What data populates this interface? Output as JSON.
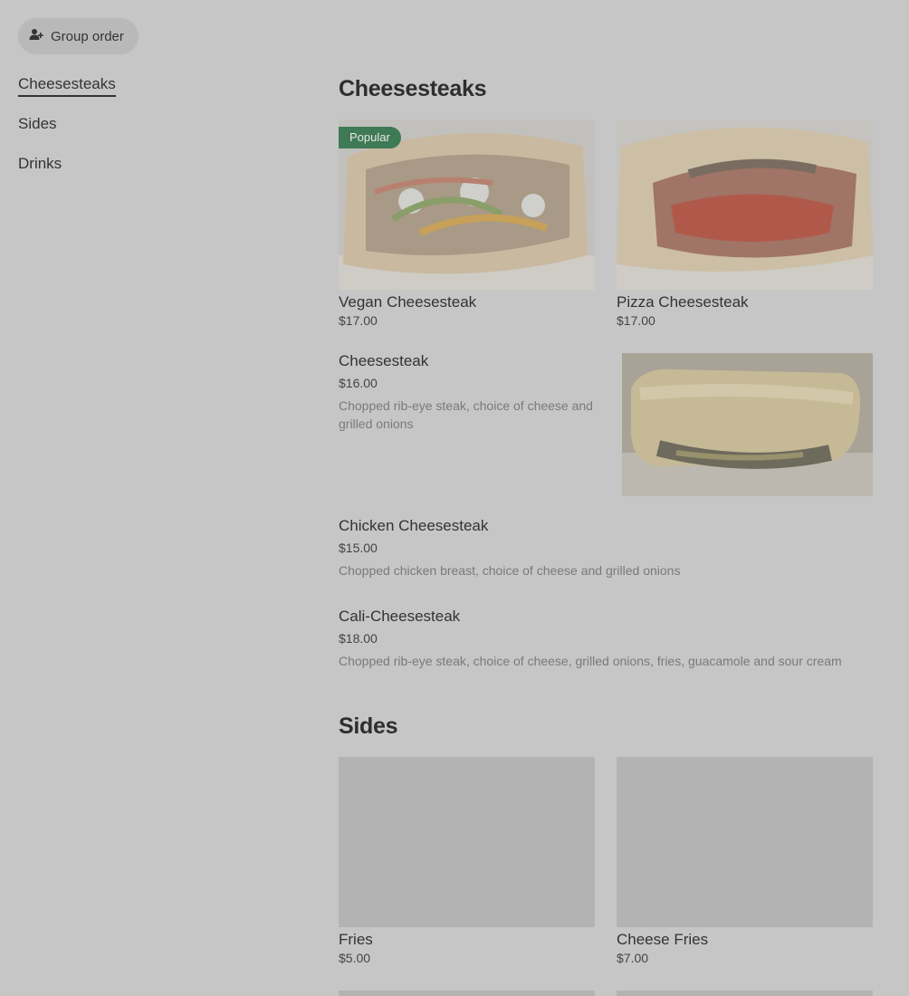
{
  "header": {
    "group_order_label": "Group order"
  },
  "nav": {
    "items": [
      {
        "label": "Cheesesteaks",
        "active": true
      },
      {
        "label": "Sides",
        "active": false
      },
      {
        "label": "Drinks",
        "active": false
      }
    ]
  },
  "sections": {
    "cheesesteaks": {
      "title": "Cheesesteaks",
      "cards": [
        {
          "badge": "Popular",
          "name": "Vegan Cheesesteak",
          "price": "$17.00"
        },
        {
          "name": "Pizza Cheesesteak",
          "price": "$17.00"
        }
      ],
      "rows": [
        {
          "name": "Cheesesteak",
          "price": "$16.00",
          "desc": "Chopped rib-eye steak, choice of cheese and grilled onions"
        },
        {
          "name": "Chicken Cheesesteak",
          "price": "$15.00",
          "desc": "Chopped chicken breast, choice of cheese and grilled onions"
        },
        {
          "name": "Cali-Cheesesteak",
          "price": "$18.00",
          "desc": "Chopped rib-eye steak, choice of cheese, grilled onions, fries, guacamole and sour cream"
        }
      ]
    },
    "sides": {
      "title": "Sides",
      "cards": [
        {
          "name": "Fries",
          "price": "$5.00"
        },
        {
          "name": "Cheese Fries",
          "price": "$7.00"
        }
      ]
    }
  },
  "colors": {
    "background": "#c6c6c6",
    "badge": "#3e7a55",
    "placeholder": "#b3b3b3"
  }
}
